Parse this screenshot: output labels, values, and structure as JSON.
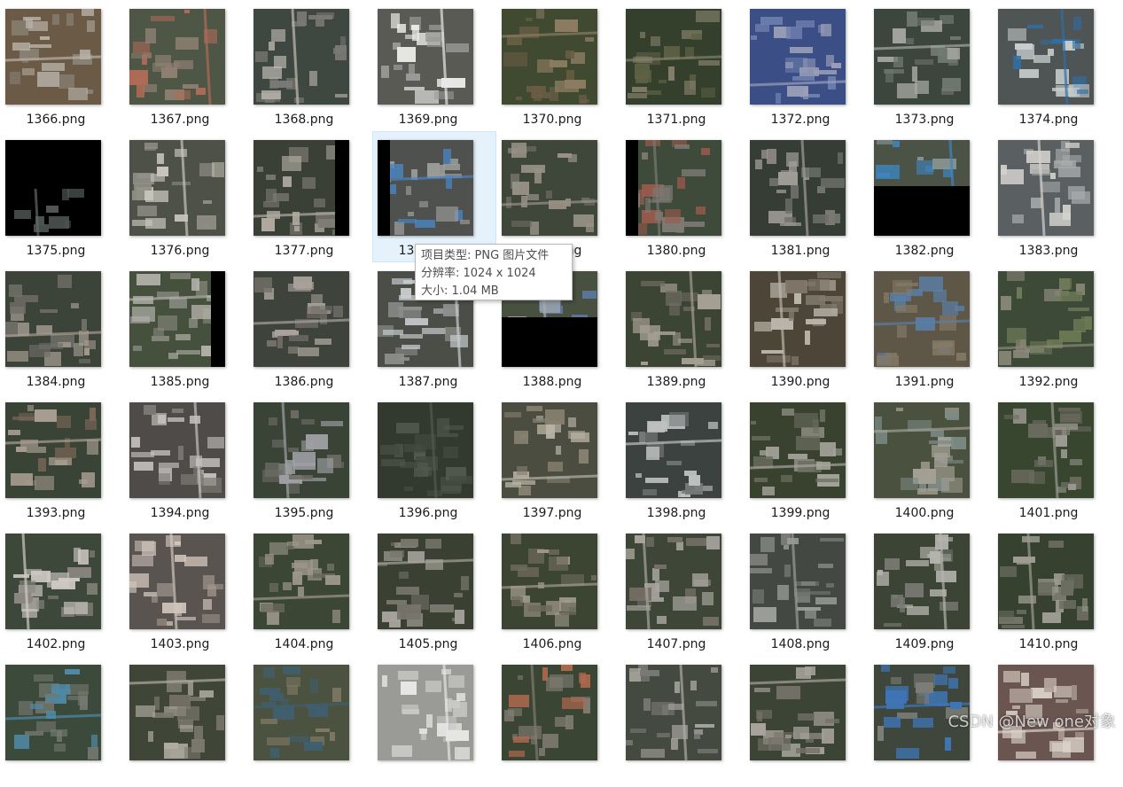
{
  "files": [
    {
      "name": "1366.png",
      "palette": [
        "#6b5a46",
        "#8a8378",
        "#b9b2a8"
      ]
    },
    {
      "name": "1367.png",
      "palette": [
        "#4e5646",
        "#8d8073",
        "#b06b57"
      ]
    },
    {
      "name": "1368.png",
      "palette": [
        "#3f4840",
        "#7c7a76",
        "#c1bdb4"
      ]
    },
    {
      "name": "1369.png",
      "palette": [
        "#5a5a55",
        "#9a9a98",
        "#e8e8e6"
      ]
    },
    {
      "name": "1370.png",
      "palette": [
        "#3f4a31",
        "#6a5d45",
        "#8c7c62"
      ]
    },
    {
      "name": "1371.png",
      "palette": [
        "#34402c",
        "#5d6145",
        "#85806c"
      ]
    },
    {
      "name": "1372.png",
      "palette": [
        "#3b4f86",
        "#6f7fae",
        "#9b9fb7"
      ]
    },
    {
      "name": "1373.png",
      "palette": [
        "#3c463c",
        "#707872",
        "#a6a8a2"
      ]
    },
    {
      "name": "1374.png",
      "palette": [
        "#4f5454",
        "#c7cccd",
        "#2f6fa5"
      ]
    },
    {
      "name": "1375.png",
      "palette": [
        "#000000",
        "#4d5552",
        "#626a66"
      ],
      "split": "top"
    },
    {
      "name": "1376.png",
      "palette": [
        "#4d5147",
        "#8f8e85",
        "#c8c5bc"
      ]
    },
    {
      "name": "1377.png",
      "palette": [
        "#3a4036",
        "#7d7b73",
        "#b3ada2"
      ],
      "split": "right"
    },
    {
      "name": "1378.png",
      "palette": [
        "#4e514d",
        "#9c9c9a",
        "#4a85c2"
      ],
      "split": "left"
    },
    {
      "name": "1379.png",
      "palette": [
        "#3e4739",
        "#6e6c63",
        "#989286"
      ]
    },
    {
      "name": "1380.png",
      "palette": [
        "#3e4a3a",
        "#9b5a4c",
        "#7c7a73"
      ],
      "split": "left"
    },
    {
      "name": "1381.png",
      "palette": [
        "#363d34",
        "#6d6f6a",
        "#a09d96"
      ]
    },
    {
      "name": "1382.png",
      "palette": [
        "#4b5347",
        "#8d9895",
        "#3e86c2"
      ],
      "split": "bottom"
    },
    {
      "name": "1383.png",
      "palette": [
        "#5a5f62",
        "#a9abab",
        "#d4d2ce"
      ]
    },
    {
      "name": "1384.png",
      "palette": [
        "#3c4338",
        "#6f6e68",
        "#a89e93"
      ]
    },
    {
      "name": "1385.png",
      "palette": [
        "#46513d",
        "#878a80",
        "#b6b4ae"
      ],
      "split": "right"
    },
    {
      "name": "1386.png",
      "palette": [
        "#3e443c",
        "#747069",
        "#a8a29a"
      ]
    },
    {
      "name": "1387.png",
      "palette": [
        "#4a4e47",
        "#8e8f8c",
        "#c9cdd0"
      ]
    },
    {
      "name": "1388.png",
      "palette": [
        "#48503f",
        "#5b77a0",
        "#a9acae"
      ],
      "split": "bottom"
    },
    {
      "name": "1389.png",
      "palette": [
        "#3c4434",
        "#716c62",
        "#a59e93"
      ]
    },
    {
      "name": "1390.png",
      "palette": [
        "#4d4538",
        "#827a6d",
        "#bcb6ac"
      ]
    },
    {
      "name": "1391.png",
      "palette": [
        "#5e5646",
        "#857a66",
        "#5a7fa6"
      ]
    },
    {
      "name": "1392.png",
      "palette": [
        "#3e4a38",
        "#6c7a55",
        "#8a8878"
      ]
    },
    {
      "name": "1393.png",
      "palette": [
        "#3a4436",
        "#7a6658",
        "#a99e92"
      ]
    },
    {
      "name": "1394.png",
      "palette": [
        "#4e4b48",
        "#7d7974",
        "#c4c2bf"
      ]
    },
    {
      "name": "1395.png",
      "palette": [
        "#3a4436",
        "#6c6b64",
        "#9ea0a5"
      ]
    },
    {
      "name": "1396.png",
      "palette": [
        "#323a30",
        "#434b40",
        "#525a4e"
      ]
    },
    {
      "name": "1397.png",
      "palette": [
        "#4a4d40",
        "#86806f",
        "#b7b2a4"
      ]
    },
    {
      "name": "1398.png",
      "palette": [
        "#3c4240",
        "#777b7a",
        "#bfc1c1"
      ]
    },
    {
      "name": "1399.png",
      "palette": [
        "#38422f",
        "#6a6c5d",
        "#a7a59d"
      ]
    },
    {
      "name": "1400.png",
      "palette": [
        "#4a523f",
        "#7c8a86",
        "#a39f93"
      ]
    },
    {
      "name": "1401.png",
      "palette": [
        "#38452f",
        "#6b6b5f",
        "#9d9b94"
      ]
    },
    {
      "name": "1402.png",
      "palette": [
        "#3d473a",
        "#8b8780",
        "#d0ccc5"
      ]
    },
    {
      "name": "1403.png",
      "palette": [
        "#5a5450",
        "#9f948d",
        "#d0c6bd"
      ]
    },
    {
      "name": "1404.png",
      "palette": [
        "#3b4635",
        "#6c6a5f",
        "#9d978b"
      ]
    },
    {
      "name": "1405.png",
      "palette": [
        "#3a4132",
        "#77756c",
        "#a6a29b"
      ]
    },
    {
      "name": "1406.png",
      "palette": [
        "#3c4432",
        "#6e6a5c",
        "#a09a8d"
      ]
    },
    {
      "name": "1407.png",
      "palette": [
        "#3e4737",
        "#756f66",
        "#a8a59f"
      ]
    },
    {
      "name": "1408.png",
      "palette": [
        "#444842",
        "#6e716c",
        "#9a9c98"
      ]
    },
    {
      "name": "1409.png",
      "palette": [
        "#3b4435",
        "#787a73",
        "#b5b4ae"
      ]
    },
    {
      "name": "1410.png",
      "palette": [
        "#37412f",
        "#6b6d61",
        "#9e9c93"
      ]
    },
    {
      "name": "",
      "palette": [
        "#3c4a3c",
        "#75786e",
        "#4f8aa7"
      ]
    },
    {
      "name": "",
      "palette": [
        "#404637",
        "#7d796e",
        "#b0aba1"
      ]
    },
    {
      "name": "",
      "palette": [
        "#4c5240",
        "#7f7864",
        "#3f5f6f"
      ]
    },
    {
      "name": "",
      "palette": [
        "#9a9a96",
        "#c9c9c6",
        "#e6e6e4"
      ]
    },
    {
      "name": "",
      "palette": [
        "#3b4534",
        "#b06a4d",
        "#7f7b72"
      ]
    },
    {
      "name": "",
      "palette": [
        "#444a40",
        "#7a7a74",
        "#aeaca6"
      ]
    },
    {
      "name": "",
      "palette": [
        "#3c4436",
        "#757168",
        "#a7a39b"
      ]
    },
    {
      "name": "",
      "palette": [
        "#3f473c",
        "#7d7d78",
        "#3f75b5"
      ]
    },
    {
      "name": "",
      "palette": [
        "#6a5550",
        "#b2a49a",
        "#dbd3ca"
      ]
    }
  ],
  "tooltip": {
    "type_line": "项目类型: PNG 图片文件",
    "resolution_line": "分辨率: 1024 x 1024",
    "size_line": "大小: 1.04 MB"
  },
  "watermark": "CSDN @New one对象"
}
